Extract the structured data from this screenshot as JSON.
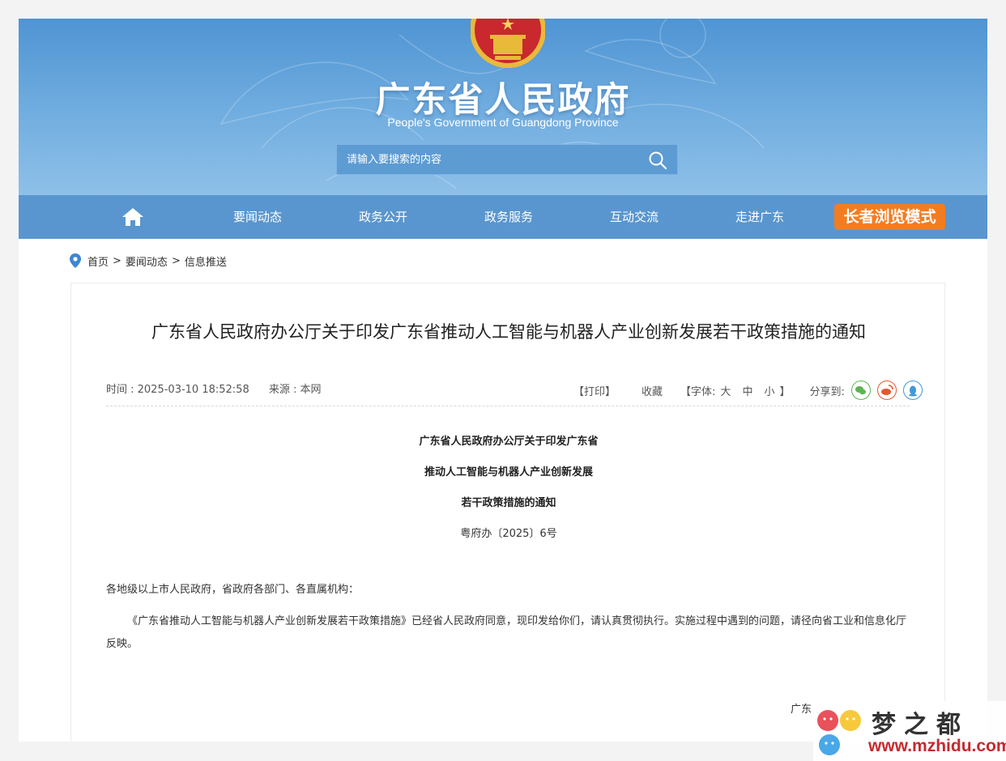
{
  "header": {
    "site_title": "广东省人民政府",
    "site_subtitle": "People's Government of Guangdong Province",
    "search_placeholder": "请输入要搜索的内容"
  },
  "nav": {
    "items": [
      "要闻动态",
      "政务公开",
      "政务服务",
      "互动交流",
      "走进广东"
    ],
    "elder_mode_label": "长者浏览模式"
  },
  "breadcrumb": [
    "首页",
    "要闻动态",
    "信息推送"
  ],
  "breadcrumb_sep": ">",
  "article": {
    "title": "广东省人民政府办公厅关于印发广东省推动人工智能与机器人产业创新发展若干政策措施的通知",
    "time": "时间 : 2025-03-10 18:52:58",
    "source": "来源 : 本网",
    "print_label": "【打印】",
    "favorite_label": "收藏",
    "font_label": "【字体:",
    "font_large": "大",
    "font_medium": "中",
    "font_small": "小",
    "font_close": "】",
    "share_label": "分享到:",
    "doc_heading_lines": [
      "广东省人民政府办公厅关于印发广东省",
      "推动人工智能与机器人产业创新发展",
      "若干政策措施的通知"
    ],
    "doc_number": "粤府办〔2025〕6号",
    "salutation": "各地级以上市人民政府，省政府各部门、各直属机构：",
    "body": "《广东省推动人工智能与机器人产业创新发展若干政策措施》已经省人民政府同意，现印发给你们，请认真贯彻执行。实施过程中遇到的问题，请径向省工业和信息化厅反映。",
    "signature": "广东"
  },
  "watermark": {
    "text": "梦之都",
    "url": "www.mzhidu.com"
  },
  "colors": {
    "nav_bg": "#5996cf",
    "elder_button": "#f47c20",
    "banner_top": "#4f94d3"
  }
}
